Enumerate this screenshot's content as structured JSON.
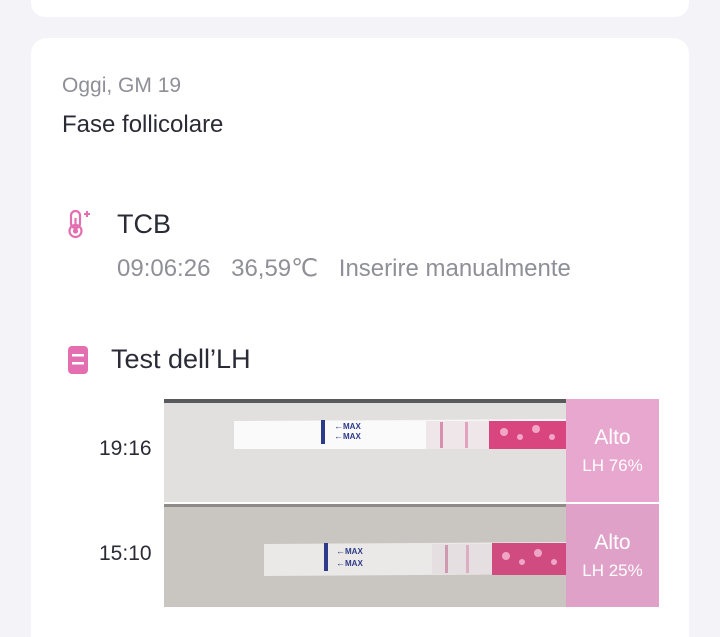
{
  "day": {
    "label": "Oggi, GM 19"
  },
  "phase": {
    "label": "Fase follicolare"
  },
  "tcb": {
    "icon": "thermometer-icon",
    "title": "TCB",
    "time": "09:06:26",
    "temperature": "36,59℃",
    "entry_mode": "Inserire manualmente"
  },
  "lh": {
    "icon": "test-strip-icon",
    "title": "Test dell’LH",
    "tests": [
      {
        "time": "19:16",
        "level": "Alto",
        "value": "LH 76%",
        "strip_text": "MAX"
      },
      {
        "time": "15:10",
        "level": "Alto",
        "value": "LH 25%",
        "strip_text": "MAX"
      }
    ]
  },
  "colors": {
    "accent": "#e46fb0",
    "result_bg": "#e8a7cf"
  }
}
